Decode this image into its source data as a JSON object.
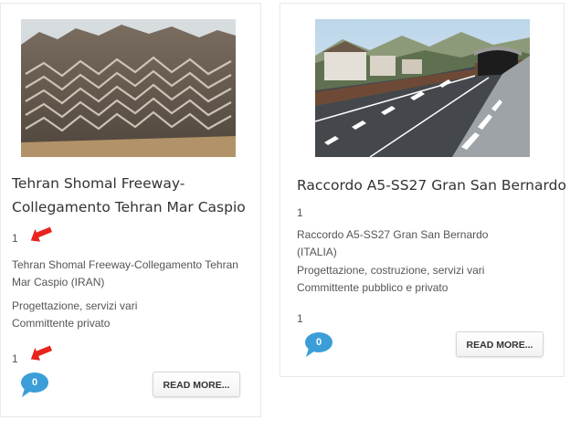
{
  "colors": {
    "arrow": "#e8231e",
    "comment_bubble": "#3b9ed9",
    "title_text": "#333333",
    "body_text": "#555555"
  },
  "cards": [
    {
      "image_alt": "Mountain slope with terraced zigzag road works",
      "title": "Tehran Shomal Freeway-Collegamento Tehran Mar Caspio",
      "number_top": "1",
      "location": "Tehran Shomal Freeway-Collegamento Tehran Mar Caspio (IRAN)",
      "services": "Progettazione, servizi vari",
      "client": "Committente privato",
      "number_bottom": "1",
      "comment_count": "0",
      "read_more_label": "READ MORE...",
      "arrow_icon": "red-arrow-icon"
    },
    {
      "image_alt": "Motorway entering tunnel in alpine village",
      "title": "Raccordo A5-SS27 Gran San Bernardo",
      "number_top": "1",
      "location": "Raccordo A5-SS27 Gran San Bernardo (ITALIA)",
      "services": "Progettazione, costruzione, servizi vari",
      "client": "Committente pubblico e privato",
      "number_bottom": "1",
      "comment_count": "0",
      "read_more_label": "READ MORE..."
    }
  ]
}
